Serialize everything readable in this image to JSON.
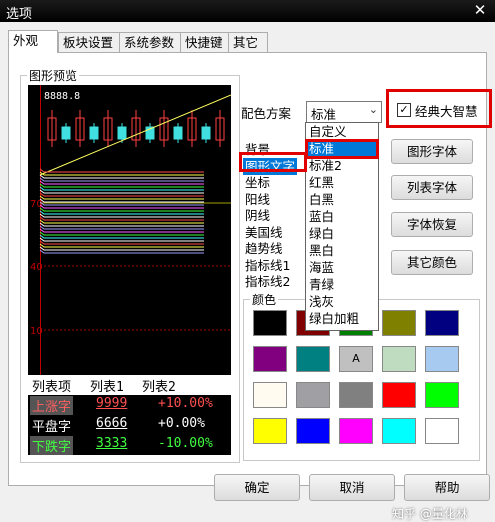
{
  "window": {
    "title": "选项",
    "close_glyph": "✕"
  },
  "tabs": [
    "外观",
    "板块设置",
    "系统参数",
    "快捷键",
    "其它"
  ],
  "preview": {
    "group_title": "图形预览",
    "top_value": "8888.8",
    "y_labels": [
      "70",
      "40",
      "10"
    ],
    "table": {
      "header": [
        "列表项",
        "列表1",
        "列表2"
      ],
      "rows": [
        {
          "name": "上涨字",
          "v1": "9999",
          "v2": "+10.00%",
          "name_color": "#ff6060",
          "name_bg": "#555",
          "v1_color": "#ff5050",
          "v2_color": "#ff5050"
        },
        {
          "name": "平盘字",
          "v1": "6666",
          "v2": "+0.00%",
          "name_color": "#ffffff",
          "name_bg": "#000",
          "v1_color": "#ffffff",
          "v2_color": "#ffffff"
        },
        {
          "name": "下跌字",
          "v1": "3333",
          "v2": "-10.00%",
          "name_color": "#40ff40",
          "name_bg": "#555",
          "v1_color": "#40ff40",
          "v2_color": "#40ff40"
        }
      ]
    }
  },
  "scheme": {
    "label": "配色方案",
    "selected": "标准",
    "options": [
      "自定义",
      "标准",
      "标准2",
      "红黑",
      "白黑",
      "蓝白",
      "绿白",
      "黑白",
      "海蓝",
      "青绿",
      "浅灰",
      "绿白加粗"
    ],
    "selected_index": 1
  },
  "classic_checkbox": {
    "label": "经典大智慧",
    "checked": true,
    "mark": "✓"
  },
  "element_list": {
    "items": [
      "背景",
      "图形文字",
      "坐标",
      "阳线",
      "阴线",
      "美国线",
      "趋势线",
      "指标线1",
      "指标线2"
    ],
    "selected_index": 1
  },
  "buttons": {
    "graph_font": "图形字体",
    "list_font": "列表字体",
    "font_restore": "字体恢复",
    "other_colors": "其它颜色"
  },
  "colors": {
    "group_title": "颜色",
    "swatch_text": "A",
    "swatches": [
      "#000000",
      "#800000",
      "#008000",
      "#808000",
      "#000080",
      "#800080",
      "#008080",
      "#c0c0c0",
      "#c0dcc0",
      "#a6caf0",
      "#fffbf0",
      "#a0a0a4",
      "#808080",
      "#ff0000",
      "#00ff00",
      "#ffff00",
      "#0000ff",
      "#ff00ff",
      "#00ffff",
      "#ffffff"
    ]
  },
  "footer": {
    "ok": "确定",
    "cancel": "取消",
    "help": "帮助"
  },
  "watermark": "知乎 @量化林"
}
